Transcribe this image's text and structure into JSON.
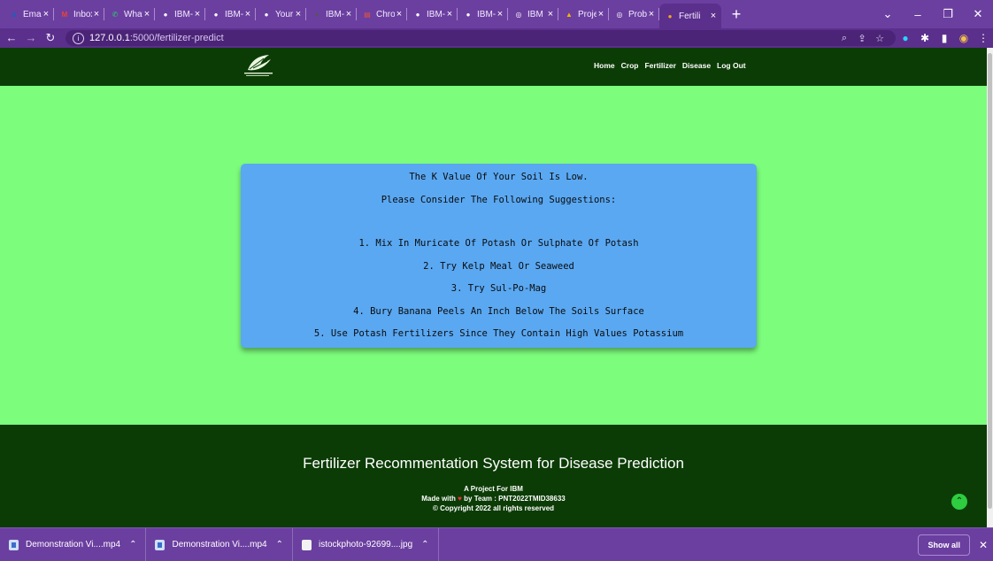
{
  "browser": {
    "tabs": [
      {
        "title": "Email",
        "icon": "outlook-icon",
        "color": "#0a64c2",
        "glyph": "o"
      },
      {
        "title": "Inbox",
        "icon": "gmail-icon",
        "color": "#ea4335",
        "glyph": "M"
      },
      {
        "title": "What",
        "icon": "whatsapp-icon",
        "color": "#25d366",
        "glyph": "✆"
      },
      {
        "title": "IBM-I",
        "icon": "github-icon",
        "color": "#ffffff",
        "glyph": "●"
      },
      {
        "title": "IBM-I",
        "icon": "github-icon",
        "color": "#ffffff",
        "glyph": "●"
      },
      {
        "title": "Your",
        "icon": "github-icon",
        "color": "#ffffff",
        "glyph": "●"
      },
      {
        "title": "IBM-I",
        "icon": "github-icon",
        "color": "#555555",
        "glyph": "●"
      },
      {
        "title": "Chro",
        "icon": "chrome-store-icon",
        "color": "#e5533d",
        "glyph": "▤"
      },
      {
        "title": "IBM-I",
        "icon": "github-icon",
        "color": "#ffffff",
        "glyph": "●"
      },
      {
        "title": "IBM-I",
        "icon": "github-icon",
        "color": "#ffffff",
        "glyph": "●"
      },
      {
        "title": "IBM",
        "icon": "globe-icon",
        "color": "#ffffff",
        "glyph": "◎"
      },
      {
        "title": "Proje",
        "icon": "drive-icon",
        "color": "#f4b400",
        "glyph": "▲"
      },
      {
        "title": "Probl",
        "icon": "globe-icon",
        "color": "#ffffff",
        "glyph": "◎"
      },
      {
        "title": "Fertili",
        "icon": "app-favicon-icon",
        "color": "#f5a623",
        "glyph": "●",
        "active": true
      }
    ],
    "url_host": "127.0.0.1",
    "url_rest": ":5000/fertilizer-predict"
  },
  "site": {
    "nav": [
      "Home",
      "Crop",
      "Fertilizer",
      "Disease",
      "Log Out"
    ]
  },
  "result": {
    "lines": [
      "The K Value Of Your Soil Is Low.",
      "Please Consider The Following Suggestions:",
      "",
      "1. Mix In Muricate Of Potash Or Sulphate Of Potash",
      "2. Try Kelp Meal Or Seaweed",
      "3. Try Sul-Po-Mag",
      "4. Bury Banana Peels An Inch Below The Soils Surface",
      "5. Use Potash Fertilizers Since They Contain High Values Potassium"
    ]
  },
  "footer": {
    "title": "Fertilizer Recommentation System for Disease Prediction",
    "project": "A Project For IBM",
    "made_with": "Made with",
    "team": "by Team : PNT2022TMID38633",
    "copyright": "© Copyright 2022 all rights reserved"
  },
  "downloads": {
    "items": [
      {
        "name": "Demonstration Vi....mp4",
        "icon": "video-file-icon"
      },
      {
        "name": "Demonstration Vi....mp4",
        "icon": "video-file-icon"
      },
      {
        "name": "istockphoto-92699....jpg",
        "icon": "image-file-icon"
      }
    ],
    "show_all": "Show all"
  },
  "colors": {
    "page_bg": "#7cfd7c",
    "header_bg": "#0c3c06",
    "card_bg": "#5aa8f2",
    "browser_frame": "#6b3fa0"
  }
}
